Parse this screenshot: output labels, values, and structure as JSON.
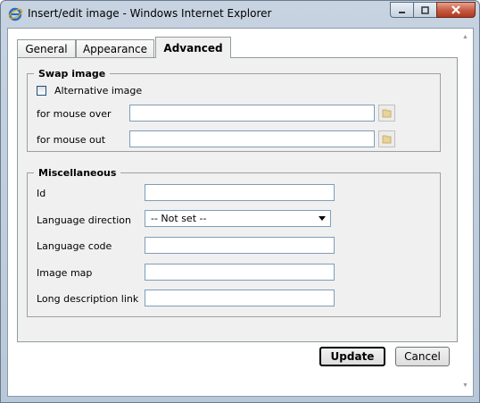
{
  "window": {
    "title": "Insert/edit image - Windows Internet Explorer",
    "accent_color": "#c45a40"
  },
  "tabs": [
    {
      "label": "General",
      "active": false
    },
    {
      "label": "Appearance",
      "active": false
    },
    {
      "label": "Advanced",
      "active": true
    }
  ],
  "swap_image": {
    "legend": "Swap image",
    "alternative_checkbox_label": "Alternative image",
    "alternative_checked": false,
    "mouse_over_label": "for mouse over",
    "mouse_over_value": "",
    "mouse_out_label": "for mouse out",
    "mouse_out_value": ""
  },
  "misc": {
    "legend": "Miscellaneous",
    "id_label": "Id",
    "id_value": "",
    "dir_label": "Language direction",
    "dir_value": "-- Not set --",
    "lang_label": "Language code",
    "lang_value": "",
    "map_label": "Image map",
    "map_value": "",
    "longdesc_label": "Long description link",
    "longdesc_value": ""
  },
  "buttons": {
    "update": "Update",
    "cancel": "Cancel"
  }
}
